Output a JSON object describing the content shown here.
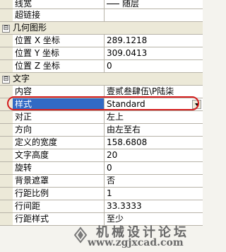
{
  "rows": [
    {
      "type": "prop",
      "label": "线宽",
      "value": "随层",
      "line_icon": true,
      "first": true
    },
    {
      "type": "prop",
      "label": "超链接",
      "value": ""
    },
    {
      "type": "cat",
      "label": "几何图形",
      "toggle": "⊟"
    },
    {
      "type": "prop",
      "label": "位置 X 坐标",
      "value": "289.1218"
    },
    {
      "type": "prop",
      "label": "位置 Y 坐标",
      "value": "309.0413"
    },
    {
      "type": "prop",
      "label": "位置 Z 坐标",
      "value": "0"
    },
    {
      "type": "cat",
      "label": "文字",
      "toggle": "⊟"
    },
    {
      "type": "prop",
      "label": "内容",
      "value": "壹贰叁肆伍\\P陆柒"
    },
    {
      "type": "prop",
      "label": "样式",
      "value": "Standard",
      "selected": true,
      "dropdown": true
    },
    {
      "type": "prop",
      "label": "对正",
      "value": "左上"
    },
    {
      "type": "prop",
      "label": "方向",
      "value": "由左至右"
    },
    {
      "type": "prop",
      "label": "定义的宽度",
      "value": "158.6808"
    },
    {
      "type": "prop",
      "label": "文字高度",
      "value": "20"
    },
    {
      "type": "prop",
      "label": "旋转",
      "value": "0"
    },
    {
      "type": "prop",
      "label": "背景遮罩",
      "value": "否"
    },
    {
      "type": "prop",
      "label": "行距比例",
      "value": "1"
    },
    {
      "type": "prop",
      "label": "行间距",
      "value": "33.3333"
    },
    {
      "type": "prop",
      "label": "行距样式",
      "value": "至少"
    }
  ],
  "watermark": {
    "title": "机械设计论坛",
    "url": "www.zgjxcad.com"
  },
  "colors": {
    "highlight": "#d41e1e",
    "selection": "#316ac5"
  }
}
